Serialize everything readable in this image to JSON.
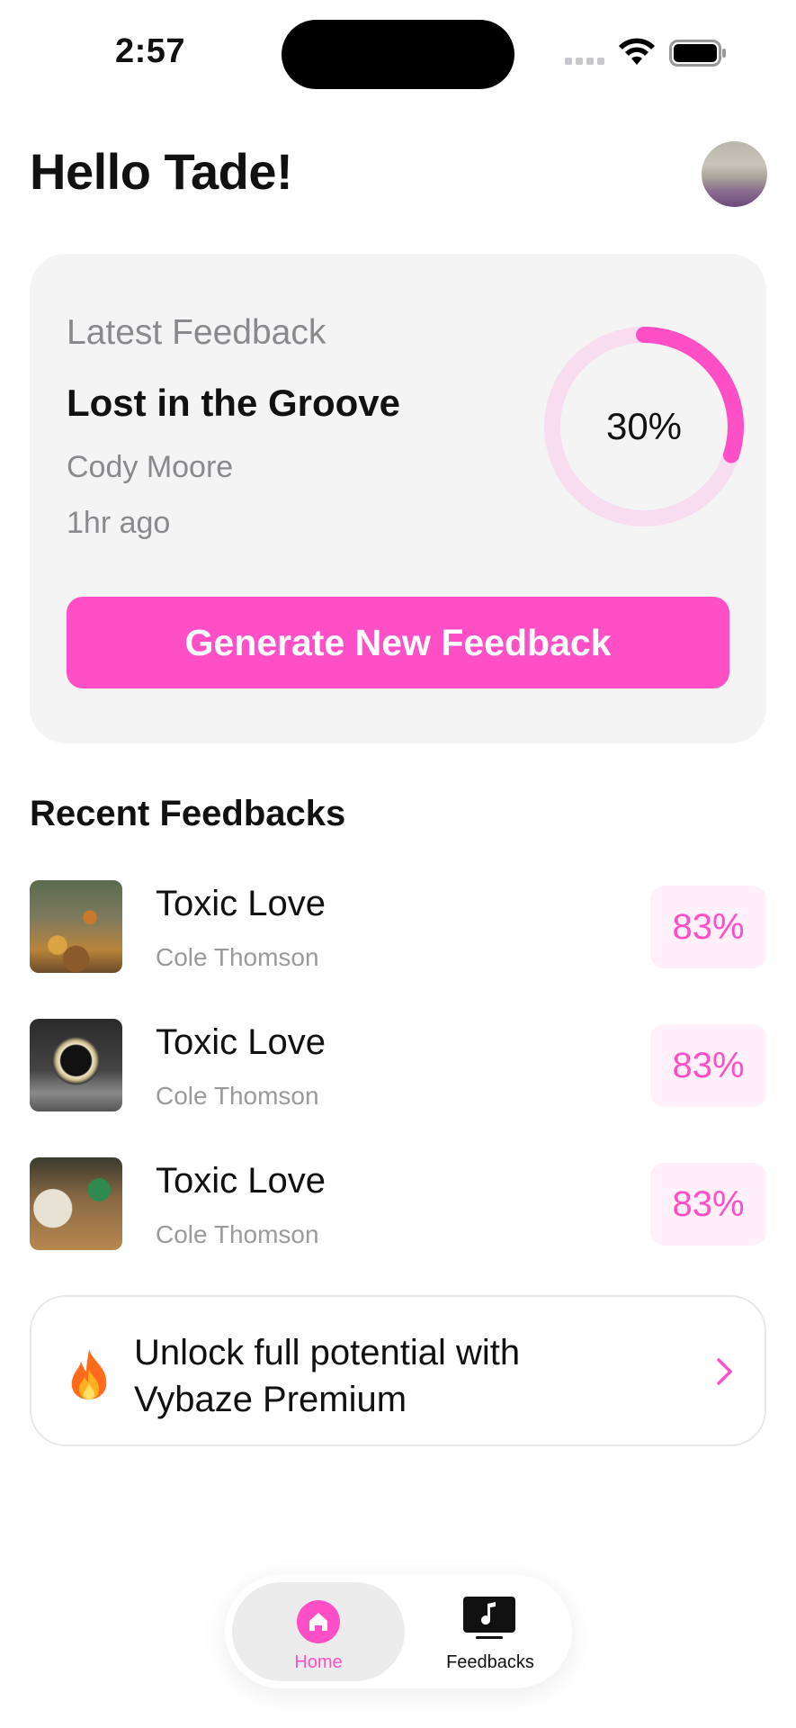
{
  "status_bar": {
    "time": "2:57",
    "icons": [
      "cellular-signal-icon",
      "wifi-icon",
      "battery-icon"
    ]
  },
  "header": {
    "greeting": "Hello Tade!",
    "avatar": "profile-avatar"
  },
  "latest_feedback": {
    "label": "Latest Feedback",
    "title": "Lost in the Groove",
    "artist": "Cody Moore",
    "time": "1hr ago",
    "score_text": "30%",
    "score_fraction": 0.3,
    "button_label": "Generate New Feedback"
  },
  "recent": {
    "title": "Recent Feedbacks",
    "items": [
      {
        "title": "Toxic Love",
        "artist": "Cole Thomson",
        "score": "83%",
        "thumbnail": "autumn-forest"
      },
      {
        "title": "Toxic Love",
        "artist": "Cole Thomson",
        "score": "83%",
        "thumbnail": "glowing-ring"
      },
      {
        "title": "Toxic Love",
        "artist": "Cole Thomson",
        "score": "83%",
        "thumbnail": "desk-notebook"
      }
    ]
  },
  "premium": {
    "icon": "fire-icon",
    "text": "Unlock full potential with Vybaze Premium",
    "chevron": "chevron-right-icon"
  },
  "nav": {
    "home_label": "Home",
    "feedbacks_label": "Feedbacks",
    "active": "Home"
  },
  "colors": {
    "accent": "#ff4fc6",
    "accent_soft": "#fff0f9",
    "card_bg": "#f4f4f5",
    "ring_track": "#f7ddef",
    "muted_text": "#8a8a8e"
  }
}
